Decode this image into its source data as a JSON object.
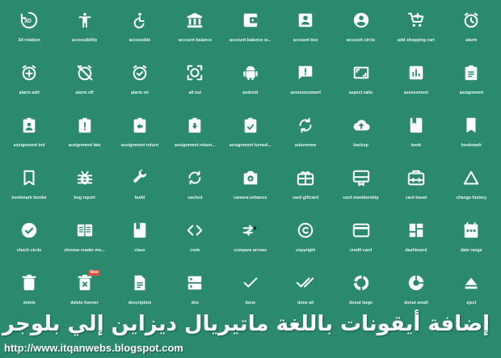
{
  "colors": {
    "background": "#2b8a6e",
    "icon": "#ffffff",
    "badge": "#e04b3c"
  },
  "icons": [
    {
      "name": "3d-rotation-icon",
      "label": "3d rotation"
    },
    {
      "name": "accessibility-icon",
      "label": "accessibility"
    },
    {
      "name": "accessible-icon",
      "label": "accessible"
    },
    {
      "name": "account-balance-icon",
      "label": "account balance"
    },
    {
      "name": "account-balance-wallet-icon",
      "label": "account balance w..."
    },
    {
      "name": "account-box-icon",
      "label": "account box"
    },
    {
      "name": "account-circle-icon",
      "label": "account circle"
    },
    {
      "name": "add-shopping-cart-icon",
      "label": "add shopping cart"
    },
    {
      "name": "alarm-icon",
      "label": "alarm"
    },
    {
      "name": "alarm-add-icon",
      "label": "alarm add"
    },
    {
      "name": "alarm-off-icon",
      "label": "alarm off"
    },
    {
      "name": "alarm-on-icon",
      "label": "alarm on"
    },
    {
      "name": "all-out-icon",
      "label": "all out"
    },
    {
      "name": "android-icon",
      "label": "android"
    },
    {
      "name": "announcement-icon",
      "label": "announcement"
    },
    {
      "name": "aspect-ratio-icon",
      "label": "aspect ratio"
    },
    {
      "name": "assessment-icon",
      "label": "assessment"
    },
    {
      "name": "assignment-icon",
      "label": "assignment"
    },
    {
      "name": "assignment-ind-icon",
      "label": "assignment ind"
    },
    {
      "name": "assignment-late-icon",
      "label": "assignment late"
    },
    {
      "name": "assignment-return-icon",
      "label": "assignment return"
    },
    {
      "name": "assignment-returned-icon",
      "label": "assignment return..."
    },
    {
      "name": "assignment-turned-in-icon",
      "label": "assignment turned..."
    },
    {
      "name": "autorenew-icon",
      "label": "autorenew"
    },
    {
      "name": "backup-icon",
      "label": "backup"
    },
    {
      "name": "book-icon",
      "label": "book"
    },
    {
      "name": "bookmark-icon",
      "label": "bookmark"
    },
    {
      "name": "bookmark-border-icon",
      "label": "bookmark border"
    },
    {
      "name": "bug-report-icon",
      "label": "bug report"
    },
    {
      "name": "build-icon",
      "label": "build"
    },
    {
      "name": "cached-icon",
      "label": "cached"
    },
    {
      "name": "camera-enhance-icon",
      "label": "camera enhance"
    },
    {
      "name": "card-giftcard-icon",
      "label": "card giftcard"
    },
    {
      "name": "card-membership-icon",
      "label": "card membership"
    },
    {
      "name": "card-travel-icon",
      "label": "card travel"
    },
    {
      "name": "change-history-icon",
      "label": "change history"
    },
    {
      "name": "check-circle-icon",
      "label": "check circle"
    },
    {
      "name": "chrome-reader-mode-icon",
      "label": "chrome reader mo..."
    },
    {
      "name": "class-icon",
      "label": "class"
    },
    {
      "name": "code-icon",
      "label": "code"
    },
    {
      "name": "compare-arrows-icon",
      "label": "compare arrows"
    },
    {
      "name": "copyright-icon",
      "label": "copyright"
    },
    {
      "name": "credit-card-icon",
      "label": "credit card"
    },
    {
      "name": "dashboard-icon",
      "label": "dashboard"
    },
    {
      "name": "date-range-icon",
      "label": "date range"
    },
    {
      "name": "delete-icon",
      "label": "delete"
    },
    {
      "name": "delete-forever-icon",
      "label": "delete forever",
      "badge": "New"
    },
    {
      "name": "description-icon",
      "label": "description"
    },
    {
      "name": "dns-icon",
      "label": "dns"
    },
    {
      "name": "done-icon",
      "label": "done"
    },
    {
      "name": "done-all-icon",
      "label": "done all"
    },
    {
      "name": "donut-large-icon",
      "label": "donut large"
    },
    {
      "name": "donut-small-icon",
      "label": "donut small"
    },
    {
      "name": "eject-icon",
      "label": "eject"
    }
  ],
  "title": "إضافة أيقونات باللغة ماتيريال ديزاين إلي بلوجر",
  "url": "http://www.itqanwebs.blogspot.com"
}
